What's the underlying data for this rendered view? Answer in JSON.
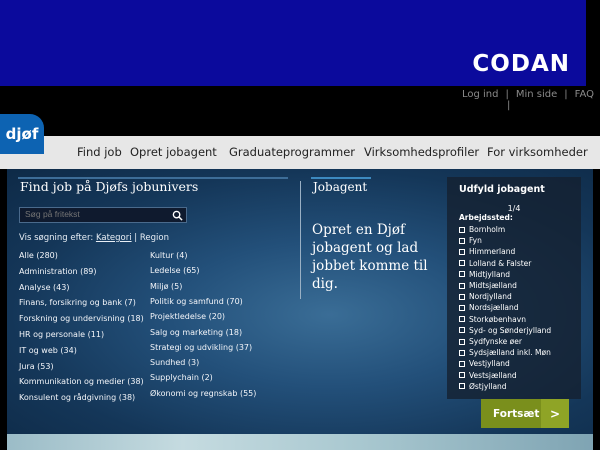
{
  "brand": {
    "logo": "CODAN",
    "site_logo": "djøf"
  },
  "userlinks": [
    "Log ind",
    "Min side",
    "FAQ"
  ],
  "nav": [
    "Find job",
    "Opret jobagent",
    "Graduateprogrammer",
    "Virksomhedsprofiler",
    "For virksomheder"
  ],
  "search": {
    "title": "Find job på Djøfs jobunivers",
    "placeholder": "Søg på fritekst",
    "viewby_prefix": "Vis søgning efter:",
    "viewby_link": "Kategori",
    "viewby_sep": "|",
    "viewby_alt": "Region"
  },
  "categories_left": [
    "Alle (280)",
    "Administration (89)",
    "Analyse (43)",
    "Finans, forsikring og bank (7)",
    "Forskning og undervisning (18)",
    "HR og personale (11)",
    "IT og web (34)",
    "Jura (53)",
    "Kommunikation og medier (38)",
    "Konsulent og rådgivning (38)"
  ],
  "categories_right": [
    "Kultur (4)",
    "Ledelse (65)",
    "Miljø (5)",
    "Politik og samfund (70)",
    "Projektledelse (20)",
    "Salg og marketing (18)",
    "Strategi og udvikling (37)",
    "Sundhed (3)",
    "Supplychain (2)",
    "Økonomi og regnskab (55)"
  ],
  "jobagent": {
    "title": "Jobagent",
    "text": "Opret en Djøf jobagent og lad jobbet komme til dig."
  },
  "panel": {
    "title": "Udfyld jobagent",
    "step": "1/4",
    "label": "Arbejdssted:",
    "options": [
      "Bornholm",
      "Fyn",
      "Himmerland",
      "Lolland & Falster",
      "Midtjylland",
      "Midtsjælland",
      "Nordjylland",
      "Nordsjælland",
      "Storkøbenhavn",
      "Syd- og Sønderjylland",
      "Sydfynske øer",
      "Sydsjælland inkl. Møn",
      "Vestjylland",
      "Vestsjælland",
      "Østjylland"
    ],
    "next_label": "Fortsæt",
    "next_arrow": ">"
  }
}
